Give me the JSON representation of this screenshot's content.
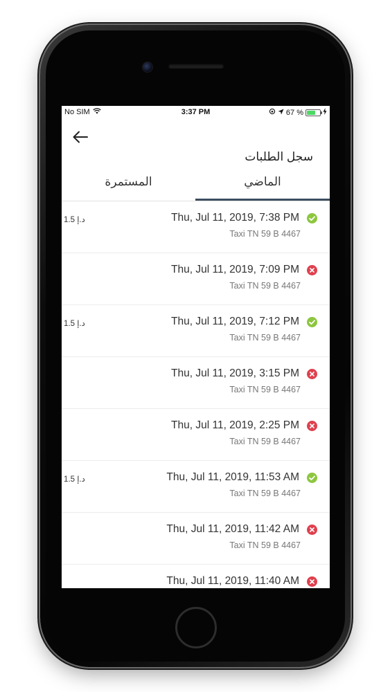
{
  "status_bar": {
    "carrier": "No SIM",
    "time": "3:37 PM",
    "battery_percent": "67 %",
    "battery_level": 0.67
  },
  "header": {
    "title": "سجل الطلبات"
  },
  "tabs": [
    {
      "label": "المستمرة",
      "selected": false
    },
    {
      "label": "الماضي",
      "selected": true
    }
  ],
  "colors": {
    "completed": "#8dc63f",
    "cancelled": "#e0404e",
    "tab_indicator": "#3c4d5e"
  },
  "orders": [
    {
      "date": "Thu, Jul 11, 2019, 7:38 PM",
      "vehicle": "Taxi TN 59 B 4467",
      "price": "1.5 د.إ",
      "status": "completed"
    },
    {
      "date": "Thu, Jul 11, 2019, 7:09 PM",
      "vehicle": "Taxi TN 59 B 4467",
      "price": "",
      "status": "cancelled"
    },
    {
      "date": "Thu, Jul 11, 2019, 7:12 PM",
      "vehicle": "Taxi TN 59 B 4467",
      "price": "1.5 د.إ",
      "status": "completed"
    },
    {
      "date": "Thu, Jul 11, 2019, 3:15 PM",
      "vehicle": "Taxi TN 59 B 4467",
      "price": "",
      "status": "cancelled"
    },
    {
      "date": "Thu, Jul 11, 2019, 2:25 PM",
      "vehicle": "Taxi TN 59 B 4467",
      "price": "",
      "status": "cancelled"
    },
    {
      "date": "Thu, Jul 11, 2019, 11:53 AM",
      "vehicle": "Taxi TN 59 B 4467",
      "price": "1.5 د.إ",
      "status": "completed"
    },
    {
      "date": "Thu, Jul 11, 2019, 11:42 AM",
      "vehicle": "Taxi TN 59 B 4467",
      "price": "",
      "status": "cancelled"
    },
    {
      "date": "Thu, Jul 11, 2019, 11:40 AM",
      "vehicle": "",
      "price": "",
      "status": "cancelled"
    }
  ]
}
